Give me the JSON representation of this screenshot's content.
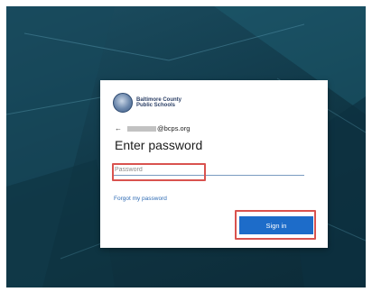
{
  "login": {
    "org_line1": "Baltimore County",
    "org_line2": "Public Schools",
    "email_suffix": "@bcps.org",
    "title": "Enter password",
    "password_placeholder": "Password",
    "forgot_link": "Forgot my password",
    "signin_button": "Sign in"
  },
  "colors": {
    "primary_button": "#1d6cc9",
    "link": "#2e6bb4",
    "highlight_box": "#d9534f",
    "background": "#143f50"
  },
  "icons": {
    "back": "back-arrow-icon",
    "logo": "district-seal-icon"
  }
}
